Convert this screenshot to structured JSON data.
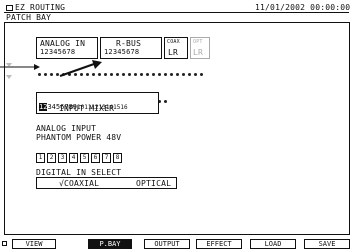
{
  "header": {
    "app_title": "EZ ROUTING",
    "date_time": "11/01/2002 00:00:00",
    "page_title": "PATCH BAY"
  },
  "patch": {
    "analog_in": {
      "label": "ANALOG IN",
      "channels": "12345678"
    },
    "r_bus": {
      "label": "R-BUS",
      "channels": "12345678"
    },
    "coax": {
      "label": "COAX",
      "channels": "LR"
    },
    "opt": {
      "label": "OPT",
      "channels": "LR"
    }
  },
  "input_mixer": {
    "label": "INPUT MIXER",
    "channels": [
      "1",
      "2",
      "3",
      "4",
      "5",
      "6",
      "7",
      "8",
      "9",
      "10",
      "11",
      "12",
      "13",
      "14",
      "15",
      "16"
    ],
    "selected_channels": [
      "1",
      "2"
    ]
  },
  "phantom": {
    "label_line1": "ANALOG INPUT",
    "label_line2": "PHANTOM POWER 48V",
    "buttons": [
      "1",
      "2",
      "3",
      "4",
      "5",
      "6",
      "7",
      "8"
    ]
  },
  "digital_in": {
    "label": "DIGITAL IN SELECT",
    "coaxial": "√COAXIAL",
    "optical": "OPTICAL"
  },
  "tabs": [
    {
      "label": "VIEW",
      "selected": false
    },
    {
      "label": "P.BAY",
      "selected": true
    },
    {
      "label": "OUTPUT",
      "selected": false
    },
    {
      "label": "EFFECT",
      "selected": false
    },
    {
      "label": "LOAD",
      "selected": false
    },
    {
      "label": "SAVE",
      "selected": false
    }
  ]
}
